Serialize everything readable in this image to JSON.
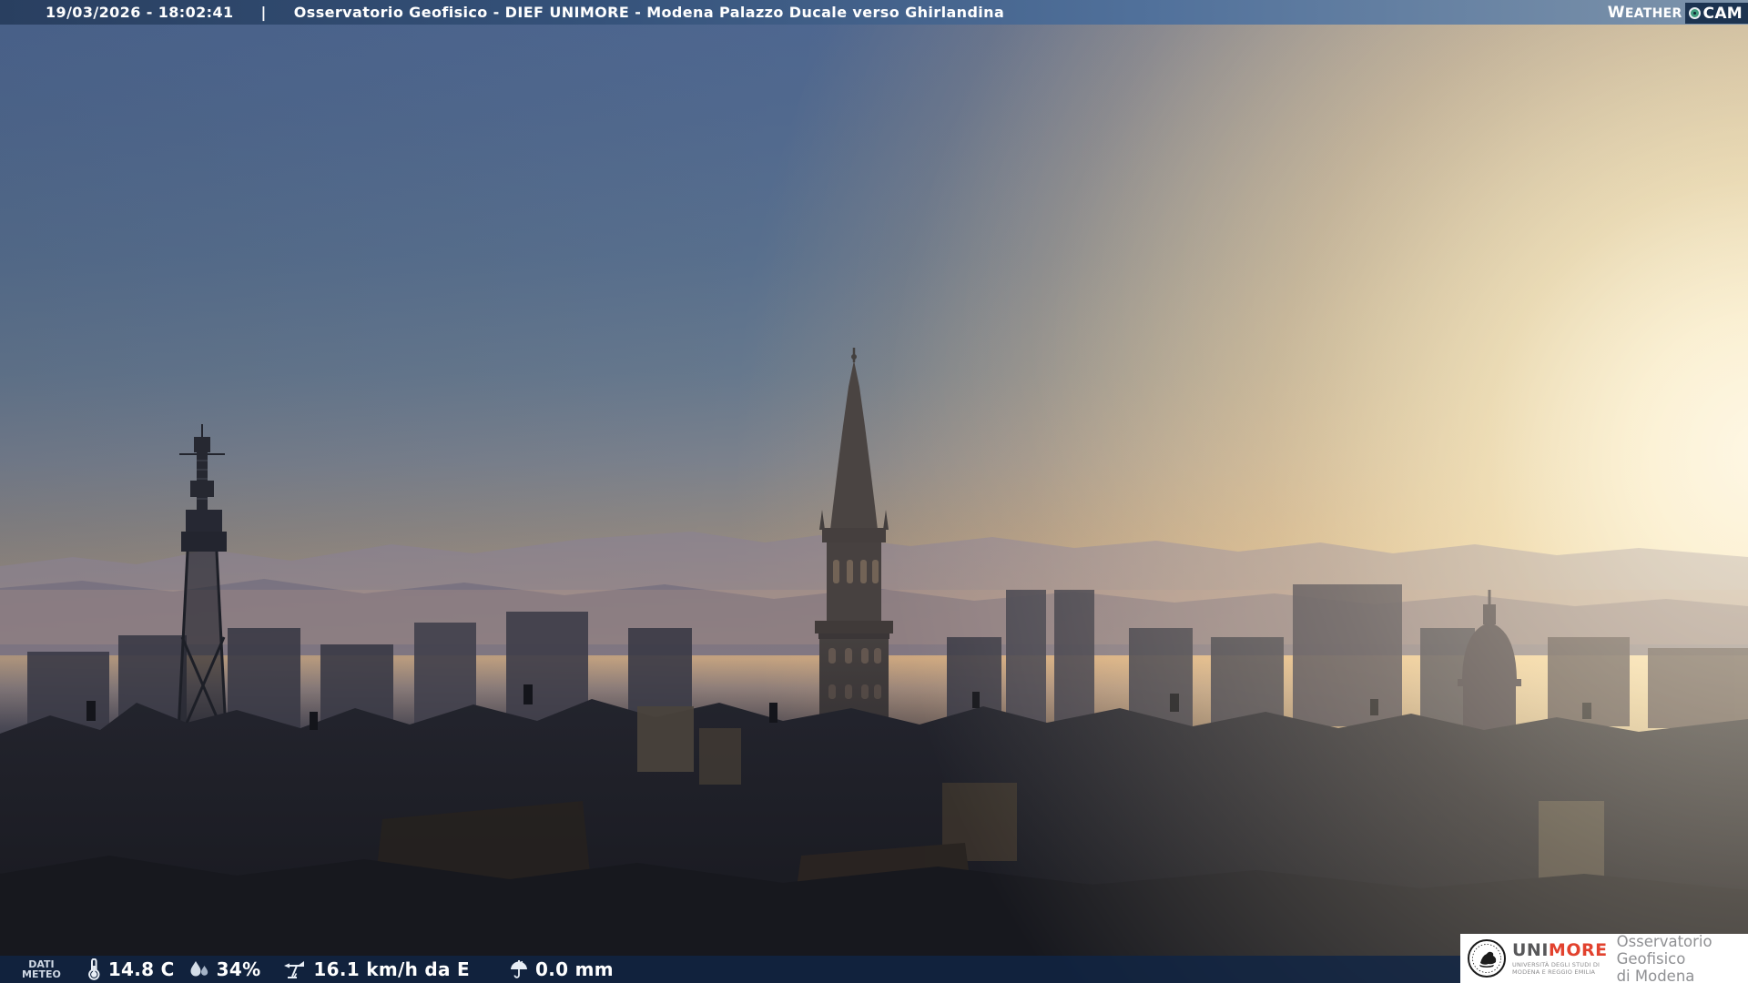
{
  "header": {
    "timestamp": "19/03/2026 - 18:02:41",
    "separator": "|",
    "title": "Osservatorio Geofisico - DIEF UNIMORE - Modena Palazzo Ducale verso Ghirlandina",
    "brand": {
      "weather_initial": "W",
      "weather_rest": "EATHER",
      "cam": "CAM"
    }
  },
  "footer": {
    "label_line1": "DATI",
    "label_line2": "METEO",
    "temperature": "14.8 C",
    "humidity": "34%",
    "wind": "16.1 km/h da E",
    "rain": "0.0 mm"
  },
  "branding": {
    "unimore_uni": "UNI",
    "unimore_more": "MORE",
    "unimore_sub1": "UNIVERSITÀ DEGLI STUDI DI",
    "unimore_sub2": "MODENA E REGGIO EMILIA",
    "org_line1": "Osservatorio Geofisico",
    "org_line2": "di Modena"
  },
  "colors": {
    "weathercam_navy": "#1c3350",
    "weathercam_teal": "#3f9d7d",
    "unimore_red": "#e2422e",
    "unimore_gray": "#58585a",
    "org_gray": "#8f9093",
    "header_navy": "#293f60",
    "footer_navy": "#102544"
  }
}
